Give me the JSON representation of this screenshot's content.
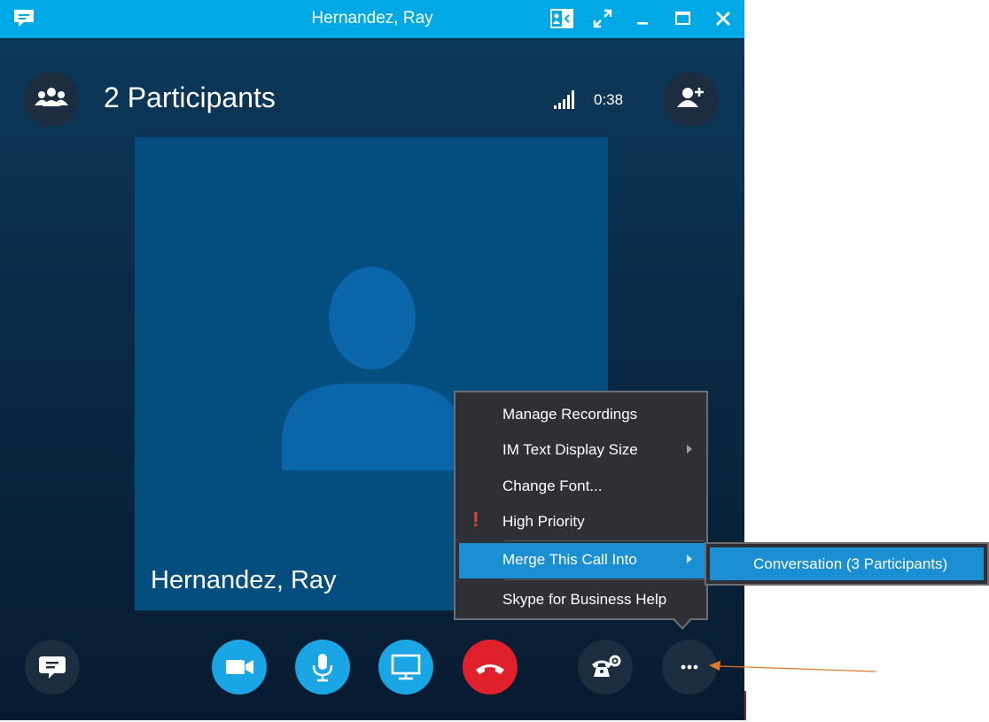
{
  "window": {
    "title": "Hernandez, Ray"
  },
  "header": {
    "participants_label": "2 Participants",
    "call_duration": "0:38"
  },
  "video": {
    "participant_name": "Hernandez, Ray"
  },
  "menu": {
    "items": [
      {
        "label": "Manage Recordings",
        "has_submenu": false
      },
      {
        "label": "IM Text Display Size",
        "has_submenu": true
      },
      {
        "label": "Change Font...",
        "has_submenu": false
      },
      {
        "label": "High Priority",
        "has_submenu": false,
        "marker": "!"
      },
      {
        "label": "Merge This Call Into",
        "has_submenu": true,
        "active": true
      },
      {
        "label": "Skype for Business Help",
        "has_submenu": false
      }
    ]
  },
  "submenu": {
    "items": [
      {
        "label": "Conversation (3 Participants)",
        "active": true
      }
    ]
  },
  "icons": {
    "app": "skype-chat-icon",
    "present_toggle": "contact-card-icon",
    "full_screen": "expand-icon",
    "minimize": "minimize-icon",
    "maximize": "maximize-icon",
    "close": "close-icon",
    "participants": "people-icon",
    "signal": "signal-strength-icon",
    "add_participant": "add-person-icon",
    "chat": "chat-bubble-icon",
    "video": "video-camera-icon",
    "mic": "microphone-icon",
    "present": "monitor-icon",
    "hang_up": "phone-hangup-icon",
    "call_controls": "phone-settings-icon",
    "more": "more-options-icon"
  },
  "colors": {
    "title_bar": "#00a9e6",
    "call_button": "#1aa6e4",
    "hang_up_button": "#e0202a",
    "menu_highlight": "#1a8fd4",
    "annotation_arrow": "#e07a2a"
  }
}
